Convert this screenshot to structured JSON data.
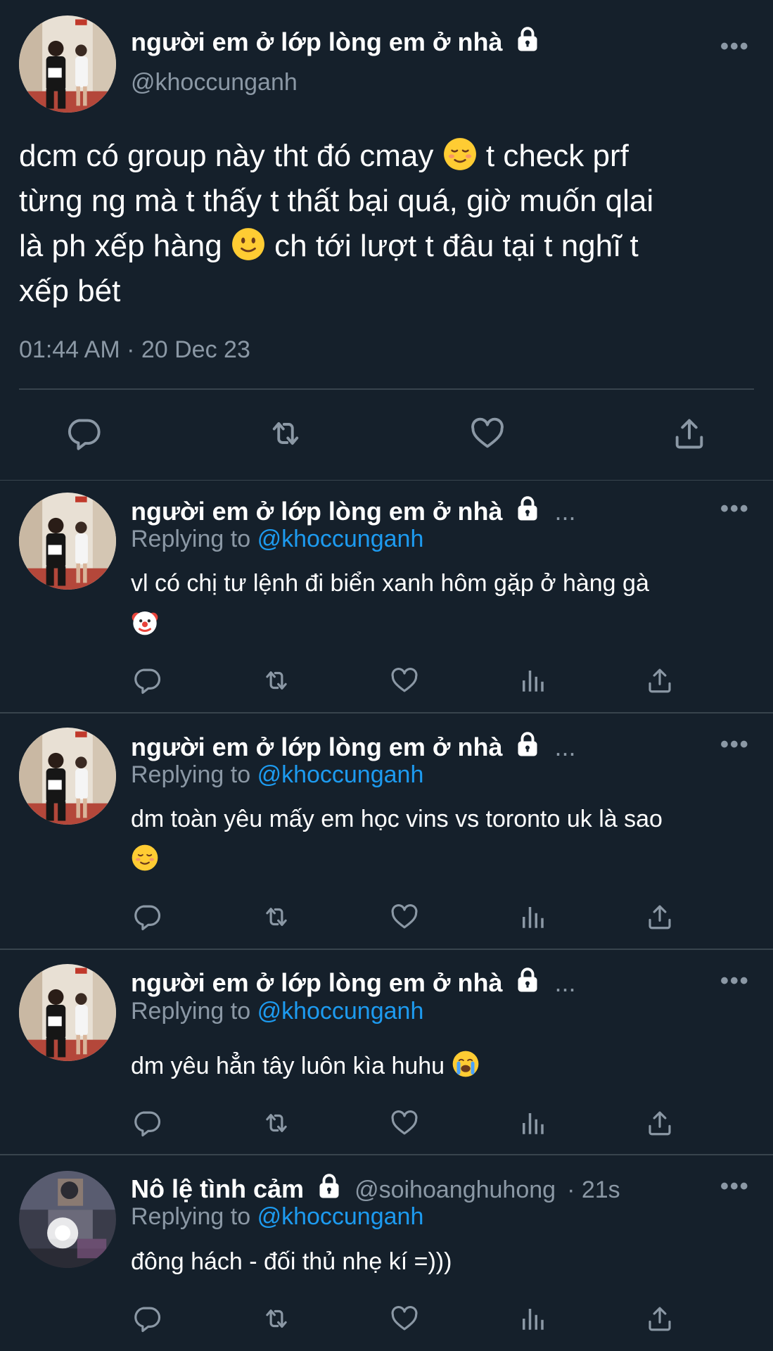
{
  "main_tweet": {
    "display_name": "người em ở lớp lòng em ở nhà",
    "handle": "@khoccunganh",
    "text_line1": "dcm có group này tht đó cmay",
    "text_line1b": "t check prf",
    "text_line2": "từng ng mà t thấy t thất bại quá, giờ muốn qlai",
    "text_line3a": "là ph xếp hàng",
    "text_line3b": "ch tới lượt t đâu tại t nghĩ t",
    "text_line4": "xếp bét",
    "timestamp": "01:44 AM · 20 Dec 23",
    "more_label": "•••",
    "actions": [
      "reply-icon",
      "retweet-icon",
      "like-icon",
      "share-icon"
    ]
  },
  "replies": [
    {
      "display_name": "người em ở lớp lòng em ở nhà",
      "ellipsis": "...",
      "replying_prefix": "Replying to",
      "replying_to": "@khoccunganh",
      "text": "vl có chị tư lệnh đi biển xanh hôm gặp ở hàng gà",
      "emoji": "clown-face-icon",
      "more_label": "•••"
    },
    {
      "display_name": "người em ở lớp lòng em ở nhà",
      "ellipsis": "...",
      "replying_prefix": "Replying to",
      "replying_to": "@khoccunganh",
      "text": "dm toàn yêu mấy em học vins vs toronto uk là sao",
      "emoji": "smiling-face-icon",
      "more_label": "•••"
    },
    {
      "display_name": "người em ở lớp lòng em ở nhà",
      "ellipsis": "...",
      "replying_prefix": "Replying to",
      "replying_to": "@khoccunganh",
      "text": "dm yêu hẳn tây luôn kìa huhu",
      "emoji": "crying-face-icon",
      "more_label": "•••"
    },
    {
      "display_name": "Nô lệ tình cảm",
      "handle": "@soihoanghuhong",
      "time": "· 21s",
      "replying_prefix": "Replying to",
      "replying_to": "@khoccunganh",
      "text": "đông hách - đối thủ nhẹ kí =)))",
      "more_label": "•••"
    }
  ],
  "colors": {
    "background": "#15202b",
    "divider": "#38444d",
    "secondary_text": "#8b98a5",
    "accent": "#1d9bf0"
  }
}
